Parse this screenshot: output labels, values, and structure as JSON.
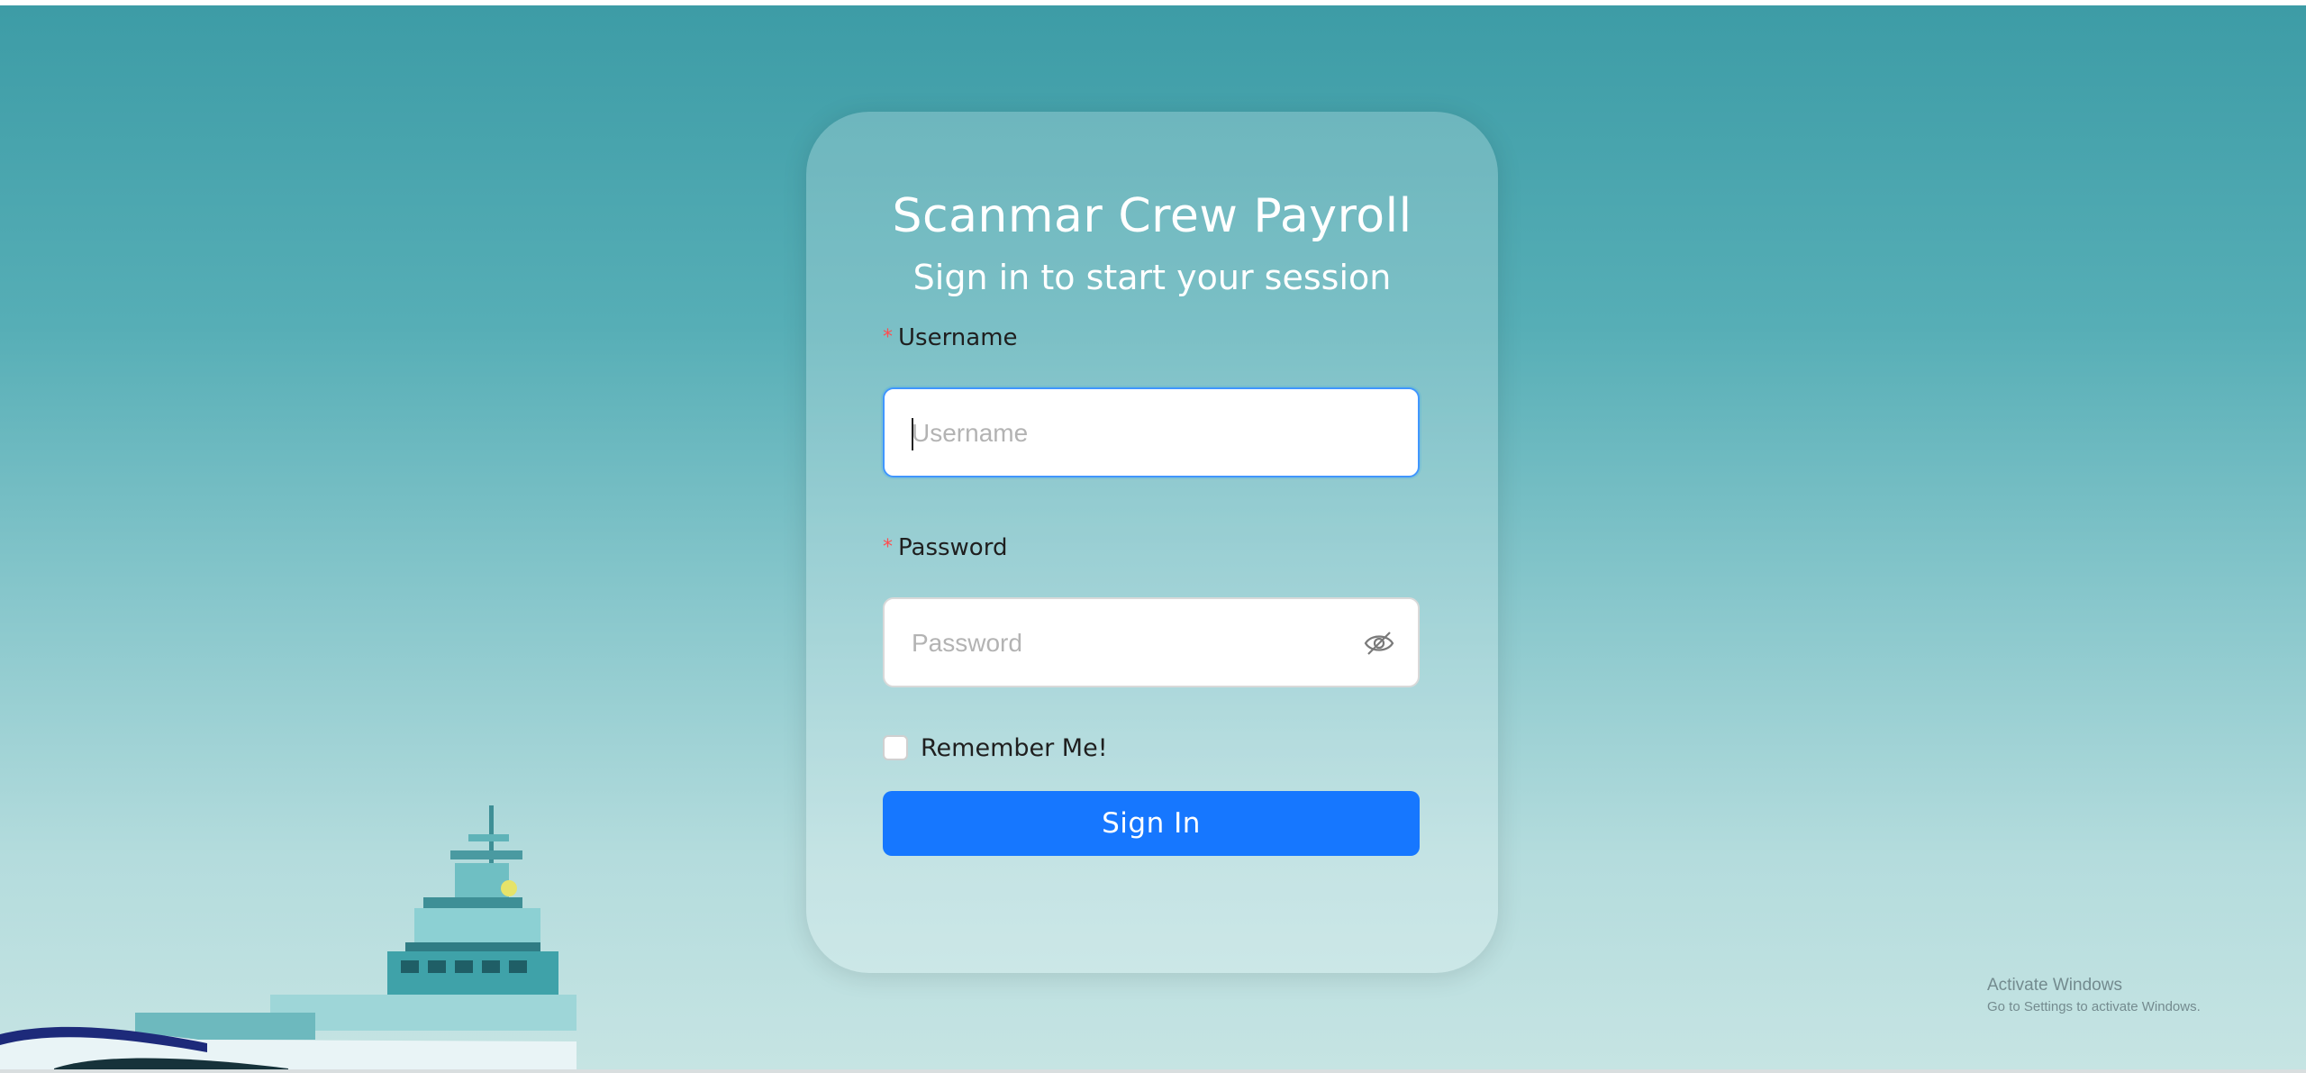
{
  "login": {
    "title": "Scanmar Crew Payroll",
    "subtitle": "Sign in to start your session",
    "username": {
      "required_mark": "*",
      "label": "Username",
      "placeholder": "Username",
      "value": ""
    },
    "password": {
      "required_mark": "*",
      "label": "Password",
      "placeholder": "Password",
      "value": "",
      "toggle_icon": "eye-invisible-icon"
    },
    "remember": {
      "label": "Remember Me!",
      "checked": false
    },
    "sign_in_label": "Sign In"
  },
  "watermark": {
    "title": "Activate Windows",
    "subtitle": "Go to Settings to activate Windows."
  },
  "colors": {
    "primary": "#1677ff",
    "focus_border": "#4096ff",
    "required": "#ff4d4f",
    "background_top": "#3d9ca6",
    "background_bottom": "#c6e4e3"
  }
}
